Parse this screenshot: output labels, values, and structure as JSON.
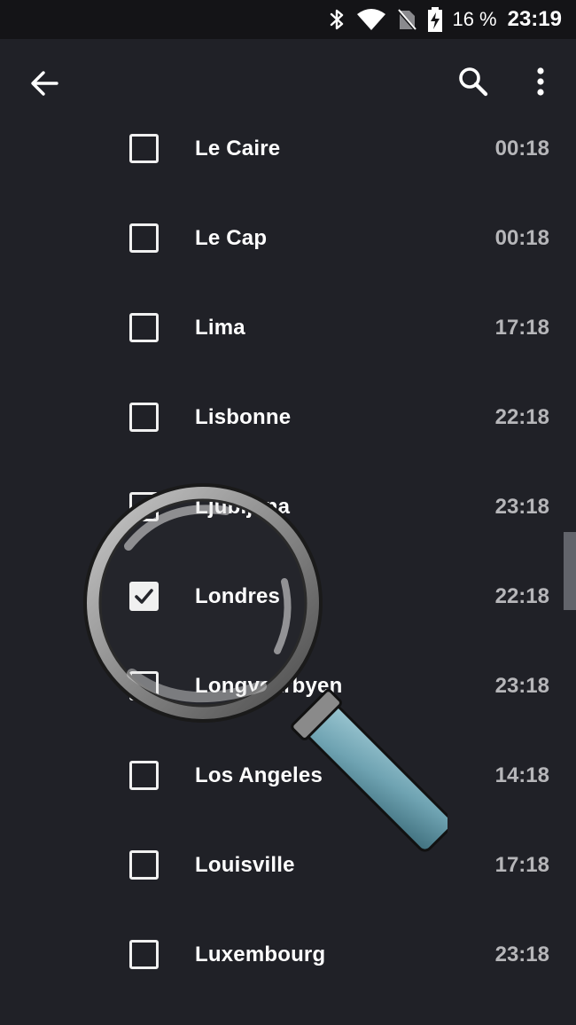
{
  "status_bar": {
    "icons": [
      "bluetooth-icon",
      "wifi-icon",
      "no-sim-icon",
      "battery-charging-icon"
    ],
    "battery_percent": "16 %",
    "time": "23:19"
  },
  "app_bar": {
    "icons": [
      "back-arrow-icon",
      "search-icon",
      "more-vert-icon"
    ]
  },
  "cities": [
    {
      "name": "Le Caire",
      "time": "00:18",
      "checked": false
    },
    {
      "name": "Le Cap",
      "time": "00:18",
      "checked": false
    },
    {
      "name": "Lima",
      "time": "17:18",
      "checked": false
    },
    {
      "name": "Lisbonne",
      "time": "22:18",
      "checked": false
    },
    {
      "name": "Ljubljana",
      "time": "23:18",
      "checked": false
    },
    {
      "name": "Londres",
      "time": "22:18",
      "checked": true
    },
    {
      "name": "Longyearbyen",
      "time": "23:18",
      "checked": false
    },
    {
      "name": "Los Angeles",
      "time": "14:18",
      "checked": false
    },
    {
      "name": "Louisville",
      "time": "17:18",
      "checked": false
    },
    {
      "name": "Luxembourg",
      "time": "23:18",
      "checked": false
    }
  ],
  "overlay": {
    "icon": "magnifying-glass-icon"
  },
  "colors": {
    "background": "#202127",
    "status_bar": "#141417",
    "text_primary": "#ffffff",
    "text_secondary": "#b6b6b9",
    "magnifier_handle": "#6fa3b2"
  }
}
